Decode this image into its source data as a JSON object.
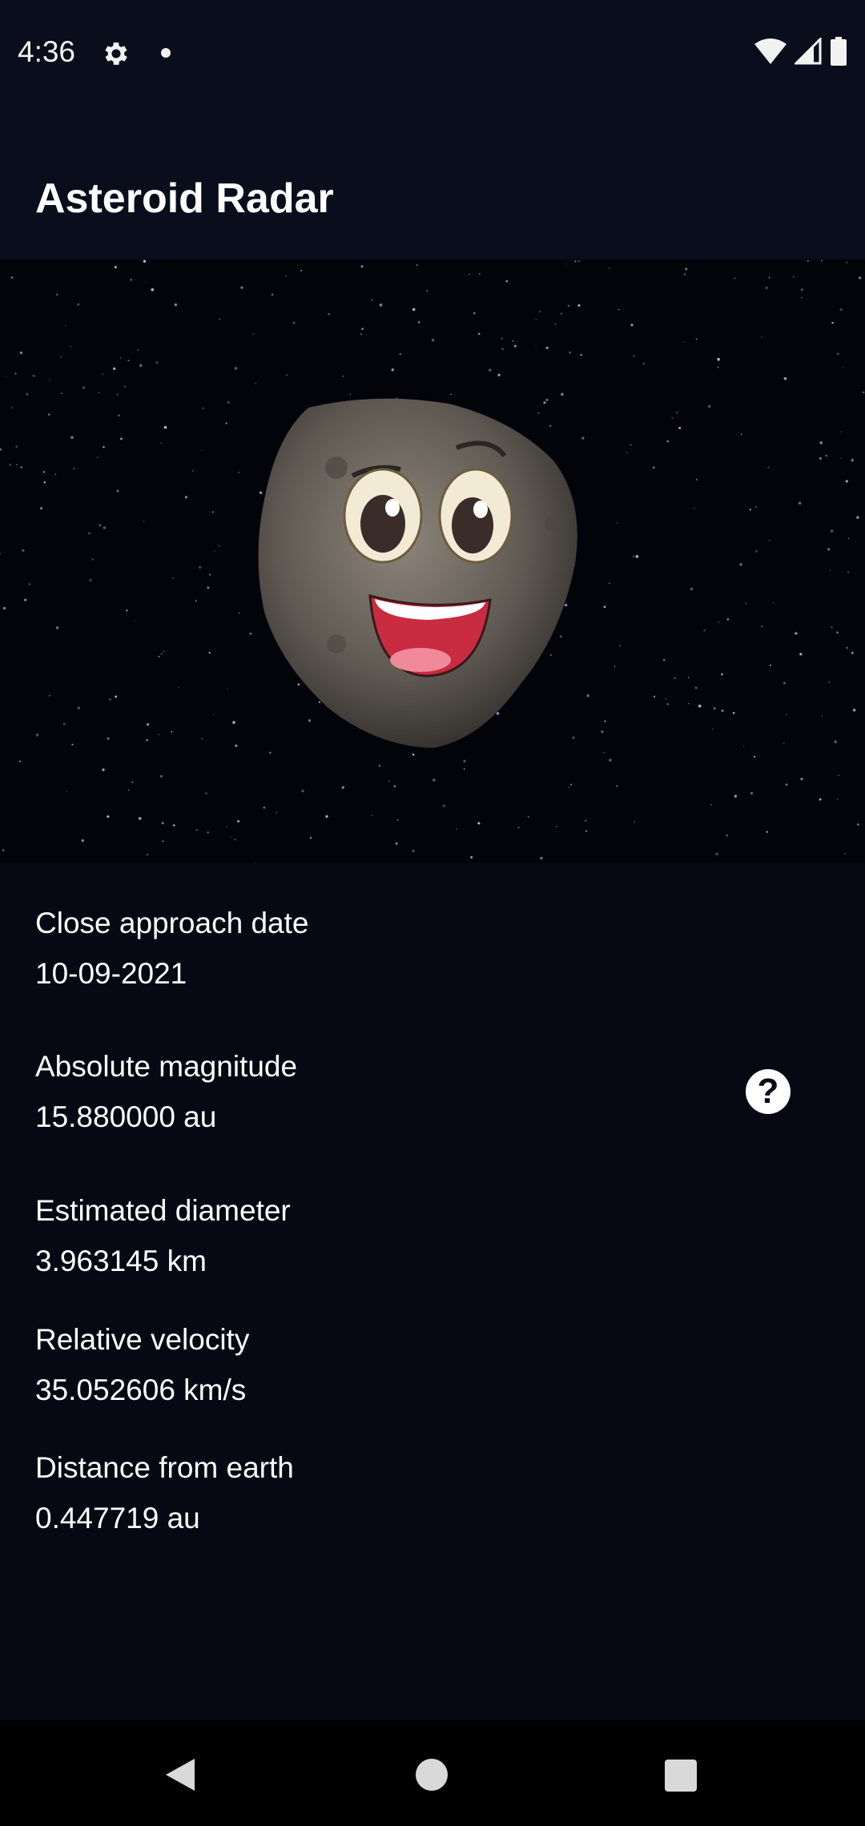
{
  "status_bar": {
    "time": "4:36",
    "icons": [
      "gear-icon",
      "notification-dot-icon",
      "wifi-icon",
      "signal-icon",
      "battery-icon"
    ]
  },
  "app_bar": {
    "title": "Asteroid Radar"
  },
  "hero_image": {
    "description_icon": "asteroid-image"
  },
  "details": {
    "close_approach_label": "Close approach date",
    "close_approach_value": "10-09-2021",
    "absolute_magnitude_label": "Absolute magnitude",
    "absolute_magnitude_value": "15.880000 au",
    "estimated_diameter_label": "Estimated diameter",
    "estimated_diameter_value": "3.963145 km",
    "relative_velocity_label": "Relative velocity",
    "relative_velocity_value": "35.052606 km/s",
    "distance_label": "Distance from earth",
    "distance_value": "0.447719 au",
    "help_icon": "help-icon",
    "help_symbol": "?"
  },
  "nav_bar": {
    "icons": [
      "back-icon",
      "home-icon",
      "recents-icon"
    ]
  },
  "colors": {
    "background": "#060814",
    "app_bar": "#0a0d1b",
    "text": "#ffffff"
  }
}
